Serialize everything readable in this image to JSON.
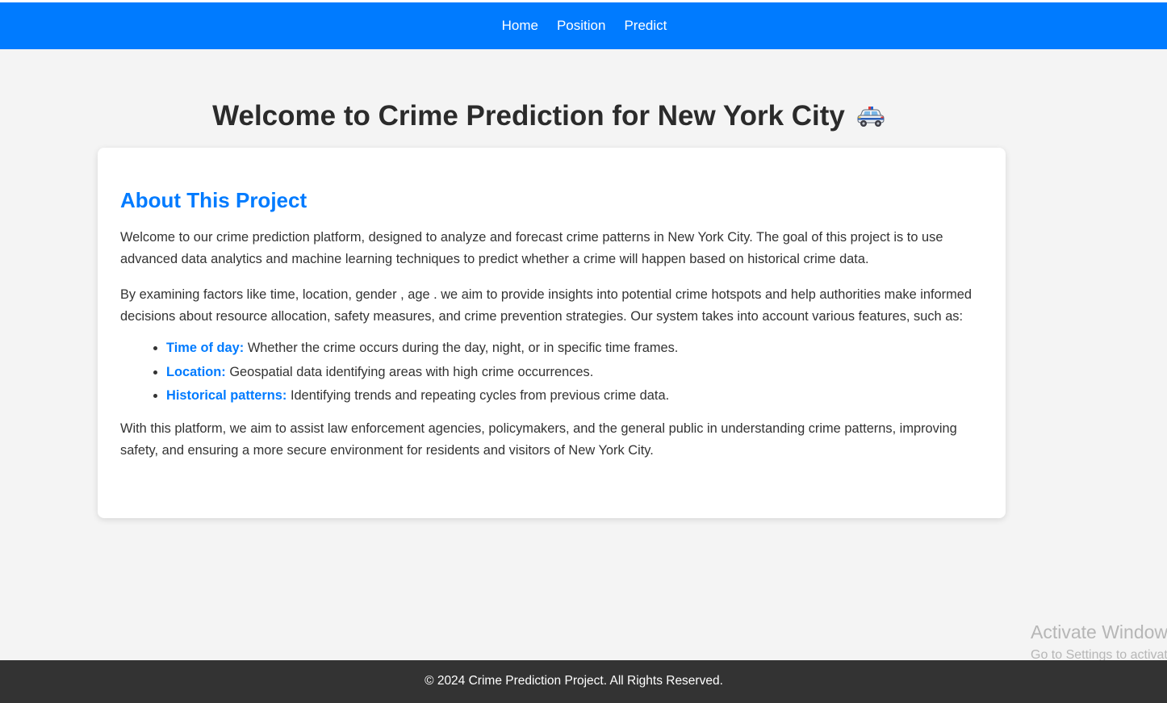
{
  "nav": {
    "items": [
      {
        "label": "Home"
      },
      {
        "label": "Position"
      },
      {
        "label": "Predict"
      }
    ]
  },
  "header": {
    "title": "Welcome to Crime Prediction for New York City",
    "title_icon": "police-car-icon"
  },
  "about": {
    "heading": "About This Project",
    "intro": "Welcome to our crime prediction platform, designed to analyze and forecast crime patterns in New York City. The goal of this project is to use advanced data analytics and machine learning techniques to predict whether a crime will happen based on historical crime data.",
    "factors": "By examining factors like time, location, gender , age . we aim to provide insights into potential crime hotspots and help authorities make informed decisions about resource allocation, safety measures, and crime prevention strategies. Our system takes into account various features, such as:",
    "features": [
      {
        "name": "Time of day:",
        "desc": "Whether the crime occurs during the day, night, or in specific time frames."
      },
      {
        "name": "Location:",
        "desc": "Geospatial data identifying areas with high crime occurrences."
      },
      {
        "name": "Historical patterns:",
        "desc": "Identifying trends and repeating cycles from previous crime data."
      }
    ],
    "closing": "With this platform, we aim to assist law enforcement agencies, policymakers, and the general public in understanding crime patterns, improving safety, and ensuring a more secure environment for residents and visitors of New York City."
  },
  "footer": {
    "text": "© 2024 Crime Prediction Project. All Rights Reserved."
  },
  "watermark": {
    "line1": "Activate Windows",
    "line2": "Go to Settings to activate Windows."
  },
  "colors": {
    "accent": "#007bff",
    "footer_bg": "#333333",
    "page_bg": "#f4f4f4"
  }
}
